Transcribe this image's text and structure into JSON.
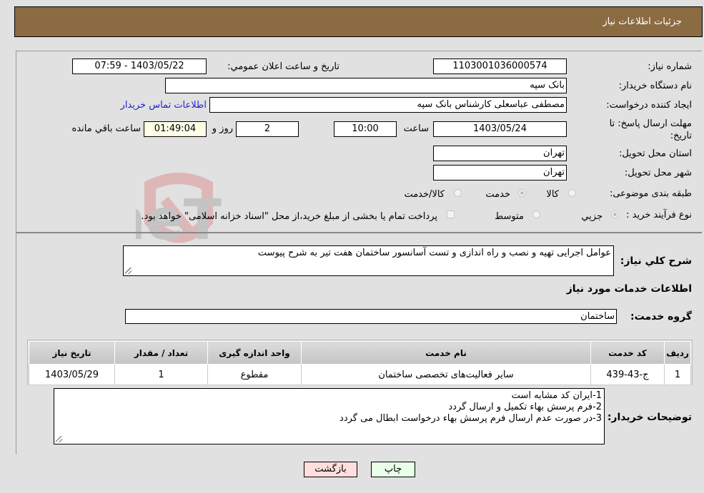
{
  "header": {
    "title": "جزئیات اطلاعات نیاز"
  },
  "form": {
    "need_number_label": "شماره نیاز:",
    "need_number": "1103001036000574",
    "announce_label": "تاریخ و ساعت اعلان عمومي:",
    "announce_value": "1403/05/22 - 07:59",
    "buyer_label": "نام دستگاه خریدار:",
    "buyer_value": "بانک سپه",
    "creator_label": "ایجاد کننده درخواست:",
    "creator_value": "مصطفی عباسعلی کارشناس بانک سپه",
    "contact_link": "اطلاعات تماس خریدار",
    "deadline_label_1": "مهلت ارسال پاسخ: تا",
    "deadline_label_2": "تاریخ:",
    "deadline_date": "1403/05/24",
    "time_label": "ساعت",
    "deadline_time": "10:00",
    "days_value": "2",
    "days_label": "روز و",
    "remaining_time": "01:49:04",
    "remaining_label": "ساعت باقي مانده",
    "province_label": "استان محل تحویل:",
    "province_value": "تهران",
    "city_label": "شهر محل تحویل:",
    "city_value": "تهران",
    "category_label": "طبقه بندی موضوعی:",
    "category_options": [
      {
        "label": "کالا",
        "checked": false
      },
      {
        "label": "خدمت",
        "checked": true
      },
      {
        "label": "کالا/خدمت",
        "checked": false
      }
    ],
    "process_label": "نوع فرآیند خرید :",
    "process_options": [
      {
        "label": "جزیي",
        "checked": true
      },
      {
        "label": "متوسط",
        "checked": false
      }
    ],
    "treasury_checkbox_label": "پرداخت تمام یا بخشی از مبلغ خرید،از محل \"اسناد خزانه اسلامی\" خواهد بود."
  },
  "description": {
    "label": "شرح کلي نیاز:",
    "value": "عوامل اجرایی تهیه و نصب و راه اندازی و تست آسانسور ساختمان هفت تیر به شرح پیوست"
  },
  "services": {
    "section_title": "اطلاعات خدمات مورد نیاز",
    "group_label": "گروه خدمت:",
    "group_value": "ساختمان",
    "columns": [
      "ردیف",
      "کد خدمت",
      "نام خدمت",
      "واحد اندازه گیری",
      "تعداد / مقدار",
      "تاریخ نیاز"
    ],
    "rows": [
      [
        "1",
        "ج-43-439",
        "سایر فعالیت‌های تخصصی ساختمان",
        "مقطوع",
        "1",
        "1403/05/29"
      ]
    ]
  },
  "buyer_notes": {
    "label": "توضیحات خریدار:",
    "lines": [
      "1-ایران کد مشابه است",
      "2-فرم پرسش بهاء تکمیل و ارسال گردد",
      "3-در صورت عدم ارسال فرم پرسش بهاء درخواست ابطال می گردد"
    ]
  },
  "buttons": {
    "print": "چاپ",
    "back": "بازگشت",
    "print_color": "#eaffea",
    "back_color": "#ffdede"
  },
  "watermark": {
    "text": "AriaTender.neT"
  }
}
